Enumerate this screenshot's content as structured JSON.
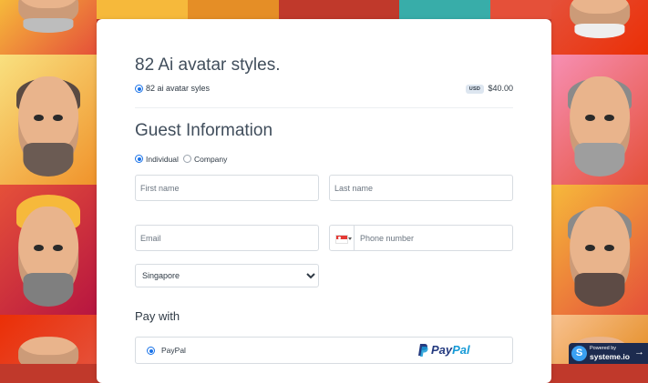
{
  "colors": {
    "accent": "#1a73e8",
    "card_background": "#ffffff",
    "field_border": "#d7dce1",
    "paypal_dark": "#253b80",
    "paypal_light": "#179bd7",
    "badge_background": "#1d2b4f"
  },
  "product": {
    "title": "82 Ai avatar styles.",
    "option_label": "82 ai avatar syles",
    "currency": "USD",
    "price": "$40.00",
    "selected": true
  },
  "guest": {
    "title": "Guest Information",
    "type_individual": "Individual",
    "type_company": "Company",
    "selected_type": "Individual",
    "first_name_placeholder": "First name",
    "last_name_placeholder": "Last name",
    "email_placeholder": "Email",
    "phone_placeholder": "Phone number",
    "phone_flag_icon": "singapore-flag-icon",
    "country_selected": "Singapore"
  },
  "payment": {
    "title": "Pay with",
    "option_label": "PayPal",
    "logo_word_1": "Pay",
    "logo_word_2": "Pal",
    "selected": true
  },
  "badge": {
    "powered_by": "Powered by",
    "brand": "systeme.io",
    "logo_letter": "S",
    "arrow": "→"
  }
}
